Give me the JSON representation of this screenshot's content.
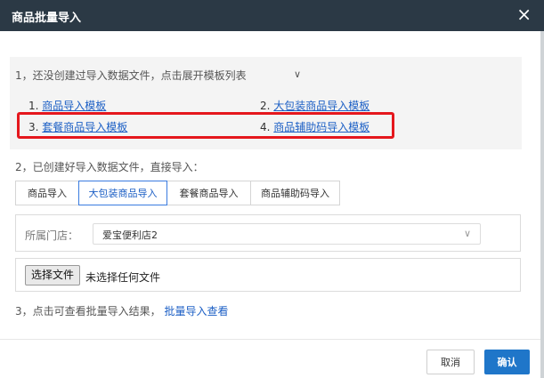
{
  "dialog": {
    "title": "商品批量导入",
    "close_icon": "×"
  },
  "step1": {
    "text": "1，还没创建过导入数据文件，点击展开模板列表",
    "chevron": "∨",
    "templates": [
      {
        "num": "1.",
        "label": "商品导入模板"
      },
      {
        "num": "2.",
        "label": "大包装商品导入模板"
      },
      {
        "num": "3.",
        "label": "套餐商品导入模板"
      },
      {
        "num": "4.",
        "label": "商品辅助码导入模板"
      }
    ]
  },
  "step2": {
    "text": "2，已创建好导入数据文件，直接导入：",
    "tabs": [
      "商品导入",
      "大包装商品导入",
      "套餐商品导入",
      "商品辅助码导入"
    ],
    "active_tab": 1
  },
  "store": {
    "label": "所属门店：",
    "value": "爱宝便利店2"
  },
  "file": {
    "button": "选择文件",
    "status": "未选择任何文件"
  },
  "step3": {
    "text": "3，点击可查看批量导入结果，",
    "link": "批量导入查看"
  },
  "footer": {
    "cancel": "取消",
    "confirm": "确认"
  },
  "colors": {
    "titlebar": "#2b3945",
    "link": "#1c5fc5",
    "primary": "#1f76c9",
    "highlight": "#e5171d"
  }
}
